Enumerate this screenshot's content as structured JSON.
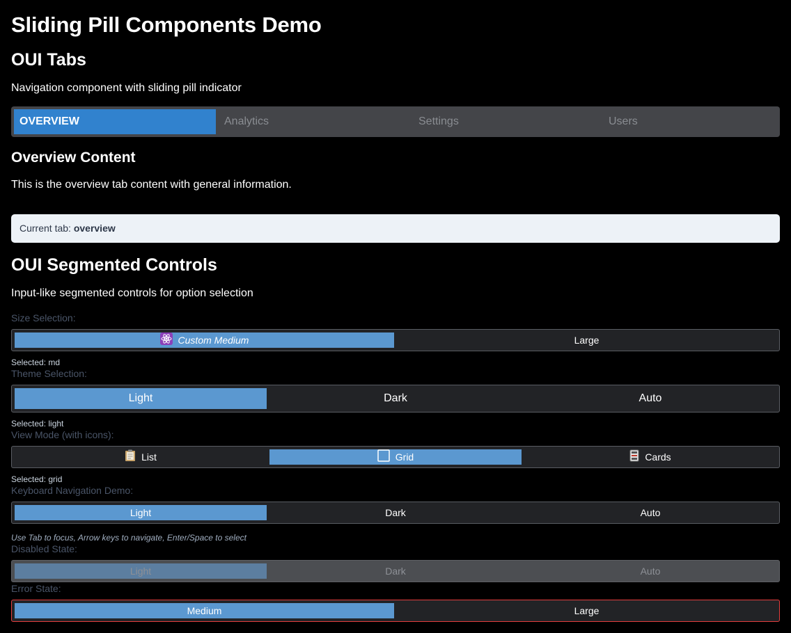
{
  "page": {
    "title": "Sliding Pill Components Demo"
  },
  "tabs_section": {
    "heading": "OUI Tabs",
    "description": "Navigation component with sliding pill indicator",
    "tabs": [
      {
        "label": "OVERVIEW",
        "active": true
      },
      {
        "label": "Analytics",
        "active": false
      },
      {
        "label": "Settings",
        "active": false
      },
      {
        "label": "Users",
        "active": false
      }
    ],
    "content_heading": "Overview Content",
    "content_text": "This is the overview tab content with general information.",
    "current_tab_prefix": "Current tab:",
    "current_tab_value": "overview"
  },
  "segmented_section": {
    "heading": "OUI Segmented Controls",
    "description": "Input-like segmented controls for option selection",
    "size": {
      "label": "Size Selection:",
      "options": [
        "Custom Medium",
        "Large"
      ],
      "selected_index": 0,
      "icon": "atom-icon",
      "selected_text": "Selected: md"
    },
    "theme": {
      "label": "Theme Selection:",
      "options": [
        "Light",
        "Dark",
        "Auto"
      ],
      "selected_index": 0,
      "selected_text": "Selected: light"
    },
    "view_mode": {
      "label": "View Mode (with icons):",
      "options": [
        {
          "label": "List",
          "icon": "clipboard-icon"
        },
        {
          "label": "Grid",
          "icon": "square-icon"
        },
        {
          "label": "Cards",
          "icon": "card-file-icon"
        }
      ],
      "selected_index": 1,
      "selected_text": "Selected: grid"
    },
    "keyboard": {
      "label": "Keyboard Navigation Demo:",
      "options": [
        "Light",
        "Dark",
        "Auto"
      ],
      "selected_index": 0,
      "hint": "Use Tab to focus, Arrow keys to navigate, Enter/Space to select"
    },
    "disabled": {
      "label": "Disabled State:",
      "options": [
        "Light",
        "Dark",
        "Auto"
      ],
      "selected_index": 0
    },
    "error": {
      "label": "Error State:",
      "options": [
        "Medium",
        "Large"
      ],
      "selected_index": 0
    }
  },
  "colors": {
    "accent": "#3182ce",
    "pill": "#5b98d0",
    "error_border": "#e53e3e"
  }
}
